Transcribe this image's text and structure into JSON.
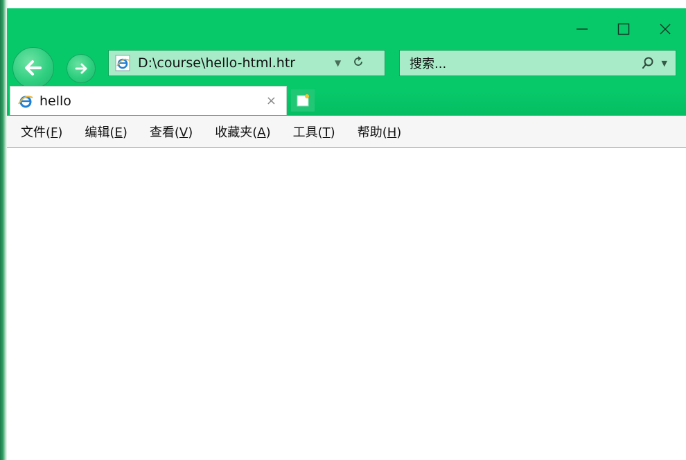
{
  "browser": {
    "address": "D:\\course\\hello-html.htr",
    "search_placeholder": "搜索...",
    "tab_title": "hello",
    "tab_close": "×"
  },
  "menu": {
    "items": [
      {
        "text": "文件(",
        "key": "F",
        "end": ")"
      },
      {
        "text": "编辑(",
        "key": "E",
        "end": ")"
      },
      {
        "text": "查看(",
        "key": "V",
        "end": ")"
      },
      {
        "text": "收藏夹(",
        "key": "A",
        "end": ")"
      },
      {
        "text": "工具(",
        "key": "T",
        "end": ")"
      },
      {
        "text": "帮助(",
        "key": "H",
        "end": ")"
      }
    ]
  },
  "icons": {
    "back": "arrow-left-icon",
    "forward": "arrow-right-icon",
    "page": "ie-logo-icon",
    "dropdown": "chevron-down-icon",
    "refresh": "refresh-icon",
    "search": "search-icon",
    "new_tab": "new-tab-icon",
    "minimize": "minimize-icon",
    "maximize": "maximize-icon",
    "close": "close-icon"
  },
  "colors": {
    "titlebar": "#07c96a",
    "field": "#a8ebc8",
    "menubar": "#f6f6f6"
  }
}
